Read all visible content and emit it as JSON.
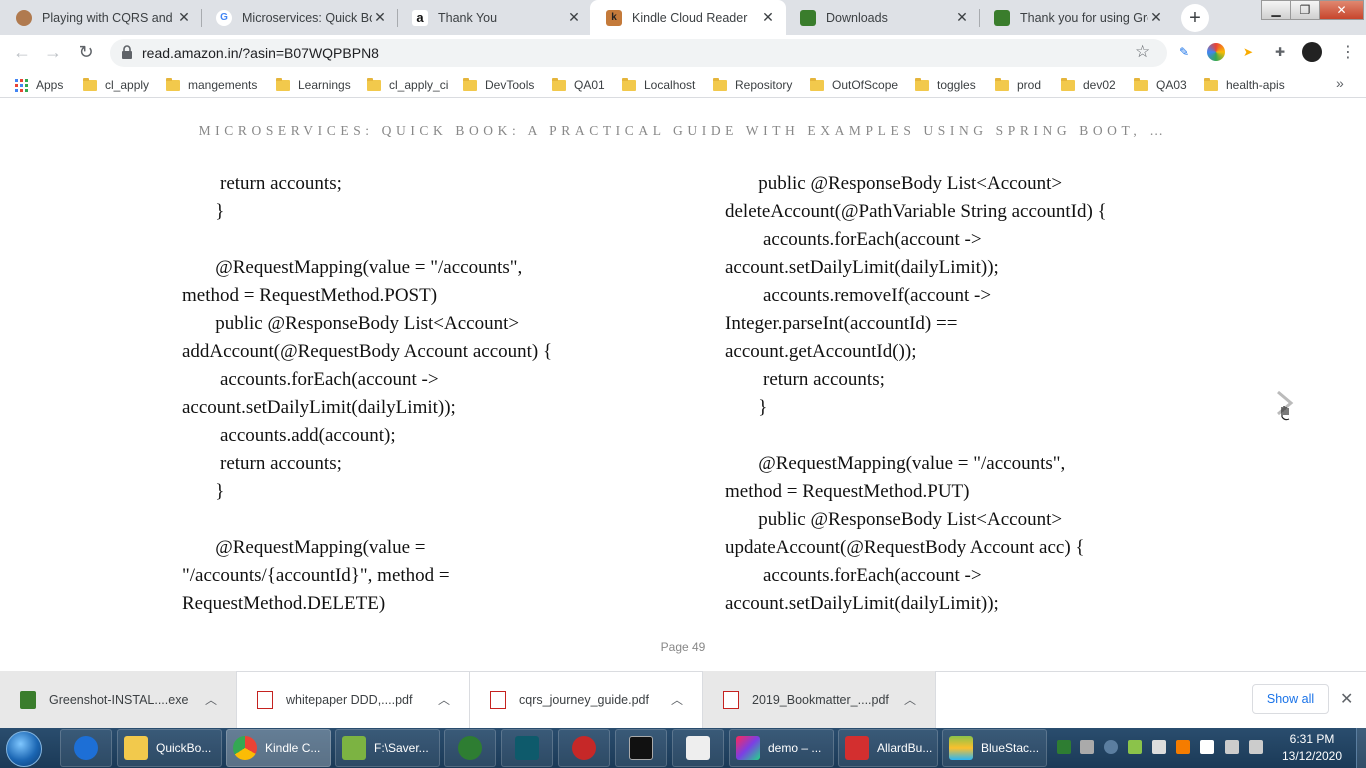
{
  "tabs": [
    {
      "title": "Playing with CQRS and E",
      "favicon": "avatar-icon",
      "active": false
    },
    {
      "title": "Microservices: Quick Boo",
      "favicon": "google-icon",
      "active": false
    },
    {
      "title": "Thank You",
      "favicon": "amazon-icon",
      "active": false
    },
    {
      "title": "Kindle Cloud Reader",
      "favicon": "kindle-icon",
      "active": true
    },
    {
      "title": "Downloads",
      "favicon": "greenshot-icon",
      "active": false
    },
    {
      "title": "Thank you for using Gre",
      "favicon": "greenshot-icon",
      "active": false
    }
  ],
  "address_bar": {
    "url": "read.amazon.in/?asin=B07WQPBPN8"
  },
  "bookmarks": {
    "apps_label": "Apps",
    "items": [
      "cl_apply",
      "mangements",
      "Learnings",
      "cl_apply_ci",
      "DevTools",
      "QA01",
      "Localhost",
      "Repository",
      "OutOfScope",
      "toggles",
      "prod",
      "dev02",
      "QA03",
      "health-apis"
    ]
  },
  "reader": {
    "book_title": "MICROSERVICES: QUICK BOOK: A PRACTICAL GUIDE WITH EXAMPLES USING SPRING BOOT, …",
    "left_column": [
      "        return accounts;",
      "       }",
      "",
      "       @RequestMapping(value = \"/accounts\",",
      "method = RequestMethod.POST)",
      "       public @ResponseBody List<Account>",
      "addAccount(@RequestBody Account account) {",
      "        accounts.forEach(account ->",
      "account.setDailyLimit(dailyLimit));",
      "        accounts.add(account);",
      "        return accounts;",
      "       }",
      "",
      "       @RequestMapping(value =",
      "\"/accounts/{accountId}\", method =",
      "RequestMethod.DELETE)"
    ],
    "right_column": [
      "       public @ResponseBody List<Account>",
      "deleteAccount(@PathVariable String accountId) {",
      "        accounts.forEach(account ->",
      "account.setDailyLimit(dailyLimit));",
      "        accounts.removeIf(account ->",
      "Integer.parseInt(accountId) ==",
      "account.getAccountId());",
      "        return accounts;",
      "       }",
      "",
      "       @RequestMapping(value = \"/accounts\",",
      "method = RequestMethod.PUT)",
      "       public @ResponseBody List<Account>",
      "updateAccount(@RequestBody Account acc) {",
      "        accounts.forEach(account ->",
      "account.setDailyLimit(dailyLimit));"
    ],
    "page_label": "Page 49"
  },
  "downloads": {
    "items": [
      {
        "name": "Greenshot-INSTAL....exe",
        "type": "exe"
      },
      {
        "name": "whitepaper DDD,....pdf",
        "type": "pdf"
      },
      {
        "name": "cqrs_journey_guide.pdf",
        "type": "pdf"
      },
      {
        "name": "2019_Bookmatter_....pdf",
        "type": "pdf"
      }
    ],
    "show_all": "Show all"
  },
  "taskbar": {
    "buttons": [
      {
        "label": "",
        "icon": "browser-icon"
      },
      {
        "label": "QuickBo...",
        "icon": "folder-icon"
      },
      {
        "label": "Kindle C...",
        "icon": "chrome-icon"
      },
      {
        "label": "F:\\Saver...",
        "icon": "notepad-icon"
      },
      {
        "label": "",
        "icon": "clock-app-icon"
      },
      {
        "label": "",
        "icon": "editor-icon"
      },
      {
        "label": "",
        "icon": "snipping-tool-icon"
      },
      {
        "label": "",
        "icon": "cmd-icon"
      },
      {
        "label": "",
        "icon": "app-icon"
      },
      {
        "label": "demo – ...",
        "icon": "intellij-icon"
      },
      {
        "label": "AllardBu...",
        "icon": "pdf-reader-icon"
      },
      {
        "label": "BlueStac...",
        "icon": "bluestacks-icon"
      }
    ],
    "time": "6:31 PM",
    "date": "13/12/2020"
  }
}
